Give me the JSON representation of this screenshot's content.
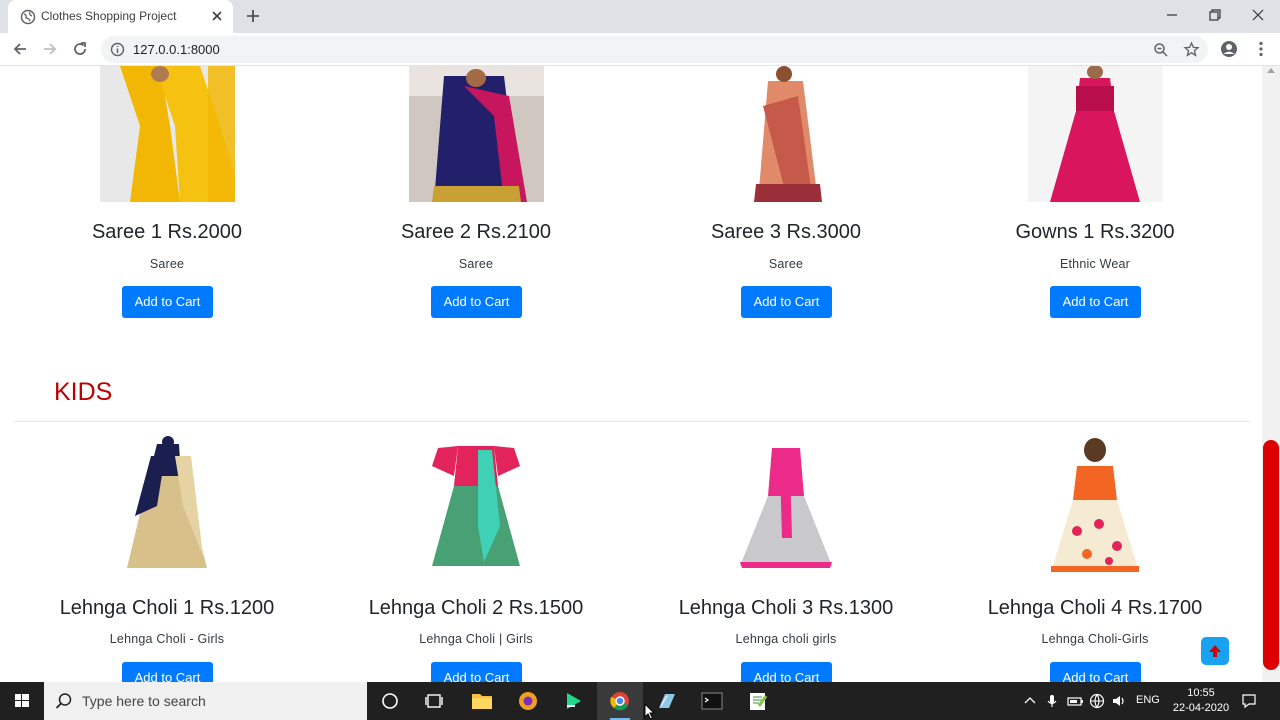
{
  "browser": {
    "tab_title": "Clothes Shopping Project",
    "url": "127.0.0.1:8000"
  },
  "products_top": [
    {
      "name": "Saree 1 Rs.2000",
      "category": "Saree",
      "button": "Add to Cart",
      "image": "yellow-saree"
    },
    {
      "name": "Saree 2 Rs.2100",
      "category": "Saree",
      "button": "Add to Cart",
      "image": "navy-pink-saree"
    },
    {
      "name": "Saree 3 Rs.3000",
      "category": "Saree",
      "button": "Add to Cart",
      "image": "peach-saree"
    },
    {
      "name": "Gowns 1 Rs.3200",
      "category": "Ethnic Wear",
      "button": "Add to Cart",
      "image": "pink-gown"
    }
  ],
  "kids_heading": "KIDS",
  "products_kids": [
    {
      "name": "Lehnga Choli 1 Rs.1200",
      "category": "Lehnga Choli - Girls",
      "button": "Add to Cart",
      "image": "navy-gold-lehnga"
    },
    {
      "name": "Lehnga Choli 2 Rs.1500",
      "category": "Lehnga Choli | Girls",
      "button": "Add to Cart",
      "image": "pink-green-lehnga"
    },
    {
      "name": "Lehnga Choli 3 Rs.1300",
      "category": "Lehnga choli girls",
      "button": "Add to Cart",
      "image": "pink-grey-lehnga"
    },
    {
      "name": "Lehnga Choli 4 Rs.1700",
      "category": "Lehnga Choli-Girls",
      "button": "Add to Cart",
      "image": "orange-floral-lehnga"
    }
  ],
  "taskbar": {
    "search_placeholder": "Type here to search",
    "language": "ENG",
    "time": "10:55",
    "date": "22-04-2020"
  },
  "colors": {
    "primary_button": "#007bff",
    "heading_red": "#c00000",
    "scroll_thumb": "#dc0000",
    "fab": "#18a2f1"
  }
}
